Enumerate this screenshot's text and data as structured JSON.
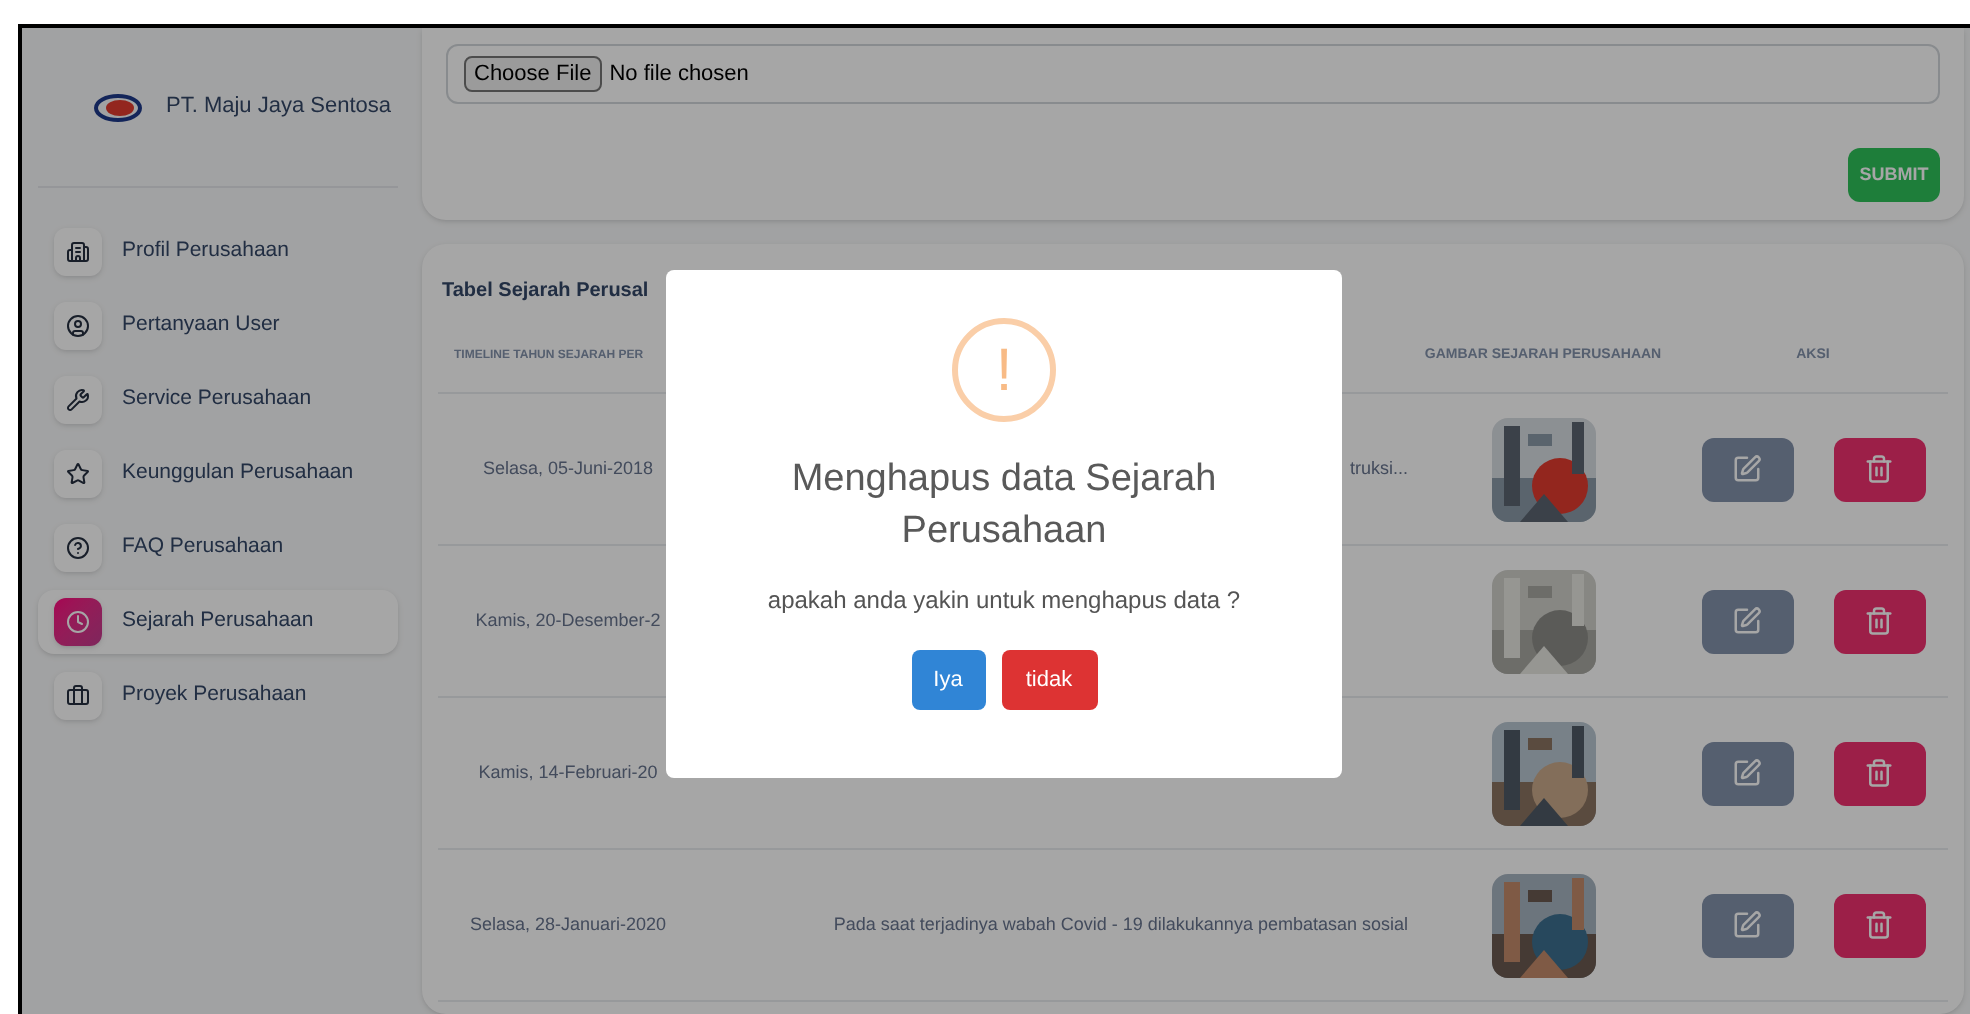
{
  "sidebar": {
    "brand": "PT. Maju Jaya Sentosa",
    "items": [
      {
        "label": "Profil Perusahaan",
        "selected": false
      },
      {
        "label": "Pertanyaan User",
        "selected": false
      },
      {
        "label": "Service Perusahaan",
        "selected": false
      },
      {
        "label": "Keunggulan Perusahaan",
        "selected": false
      },
      {
        "label": "FAQ Perusahaan",
        "selected": false
      },
      {
        "label": "Sejarah Perusahaan",
        "selected": true
      },
      {
        "label": "Proyek Perusahaan",
        "selected": false
      }
    ]
  },
  "upload": {
    "choose_button": "Choose File",
    "file_status": "No file chosen",
    "submit": "SUBMIT"
  },
  "table": {
    "title": "Tabel Sejarah Perusal",
    "columns": [
      "TIMELINE TAHUN SEJARAH PER",
      "GAMBAR SEJARAH PERUSAHAAN",
      "AKSI"
    ],
    "rows": [
      {
        "timeline": "Selasa, 05-Juni-2018",
        "description": "truksi..."
      },
      {
        "timeline": "Kamis, 20-Desember-2"
      },
      {
        "timeline": "Kamis, 14-Februari-20"
      },
      {
        "timeline": "Selasa, 28-Januari-2020",
        "description": "Pada saat terjadinya wabah Covid - 19 dilakukannya pembatasan sosial"
      }
    ]
  },
  "dialog": {
    "icon": "!",
    "title": "Menghapus data Sejarah Perusahaan",
    "message": "apakah anda yakin untuk menghapus data ?",
    "confirm": "Iya",
    "cancel": "tidak"
  }
}
